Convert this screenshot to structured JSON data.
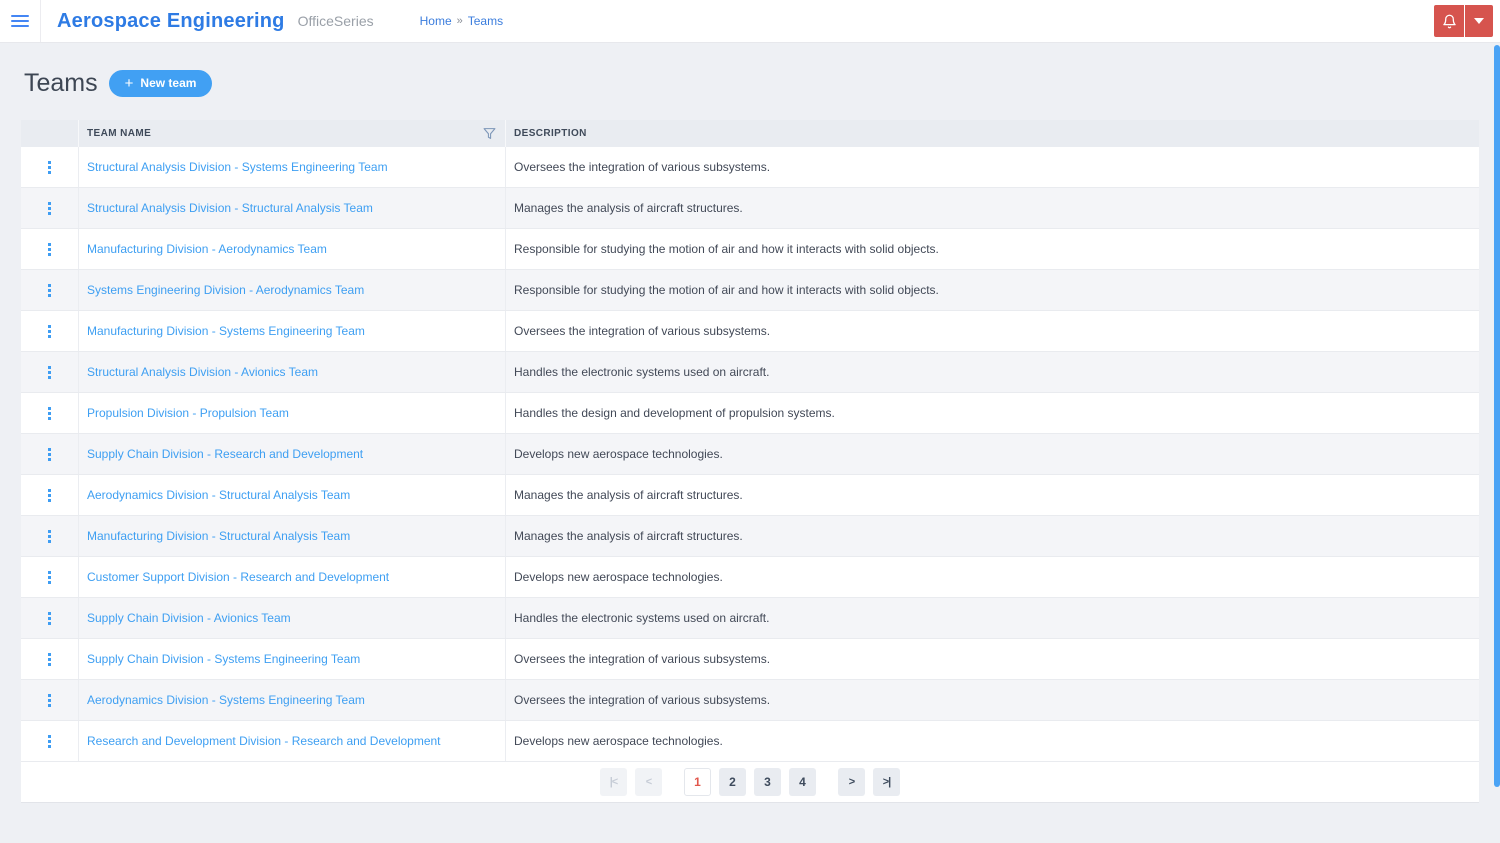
{
  "header": {
    "app_title": "Aerospace Engineering",
    "app_subtitle": "OfficeSeries",
    "breadcrumb": {
      "home": "Home",
      "separator": "»",
      "current": "Teams"
    }
  },
  "page": {
    "title": "Teams",
    "new_team_label": "New team",
    "plus_icon": "+"
  },
  "table": {
    "columns": [
      {
        "label": "TEAM NAME",
        "filter_icon": "funnel"
      },
      {
        "label": "DESCRIPTION"
      }
    ],
    "rows": [
      {
        "name": "Structural Analysis Division - Systems Engineering Team",
        "description": "Oversees the integration of various subsystems."
      },
      {
        "name": "Structural Analysis Division - Structural Analysis Team",
        "description": "Manages the analysis of aircraft structures."
      },
      {
        "name": "Manufacturing Division - Aerodynamics Team",
        "description": "Responsible for studying the motion of air and how it interacts with solid objects."
      },
      {
        "name": "Systems Engineering Division - Aerodynamics Team",
        "description": "Responsible for studying the motion of air and how it interacts with solid objects."
      },
      {
        "name": "Manufacturing Division - Systems Engineering Team",
        "description": "Oversees the integration of various subsystems."
      },
      {
        "name": "Structural Analysis Division - Avionics Team",
        "description": "Handles the electronic systems used on aircraft."
      },
      {
        "name": "Propulsion Division - Propulsion Team",
        "description": "Handles the design and development of propulsion systems."
      },
      {
        "name": "Supply Chain Division - Research and Development",
        "description": "Develops new aerospace technologies."
      },
      {
        "name": "Aerodynamics Division - Structural Analysis Team",
        "description": "Manages the analysis of aircraft structures."
      },
      {
        "name": "Manufacturing Division - Structural Analysis Team",
        "description": "Manages the analysis of aircraft structures."
      },
      {
        "name": "Customer Support Division - Research and Development",
        "description": "Develops new aerospace technologies."
      },
      {
        "name": "Supply Chain Division - Avionics Team",
        "description": "Handles the electronic systems used on aircraft."
      },
      {
        "name": "Supply Chain Division - Systems Engineering Team",
        "description": "Oversees the integration of various subsystems."
      },
      {
        "name": "Aerodynamics Division - Systems Engineering Team",
        "description": "Oversees the integration of various subsystems."
      },
      {
        "name": "Research and Development Division - Research and Development",
        "description": "Develops new aerospace technologies."
      }
    ]
  },
  "pagination": {
    "first": "|<",
    "prev": "<",
    "pages": [
      "1",
      "2",
      "3",
      "4"
    ],
    "current_page": "1",
    "next": ">",
    "last": ">|"
  },
  "icons": {
    "hamburger": "menu",
    "bell": "notifications",
    "caret_down": "dropdown",
    "filter": "funnel",
    "kebab": "row-menu"
  },
  "colors": {
    "brand_blue": "#2e7be4",
    "accent_blue": "#3e9ff2",
    "link_blue": "#3b7ddd",
    "alert_red": "#d6544e",
    "active_page_red": "#e2574c",
    "table_header_bg": "#e9ecf1",
    "alt_row_bg": "#f4f5f8",
    "page_bg": "#eef0f4",
    "scrollbar_blue": "#4aa3f5"
  }
}
